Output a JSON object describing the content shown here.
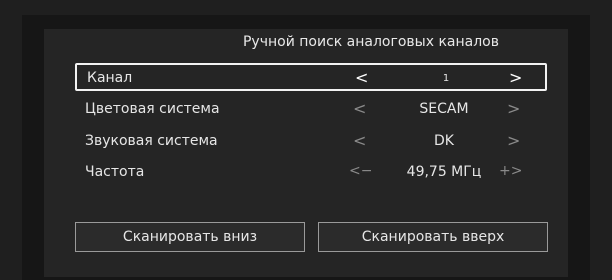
{
  "title": "Ручной поиск аналоговых каналов",
  "rows": [
    {
      "label": "Канал",
      "left": "<",
      "value": "1",
      "right": ">"
    },
    {
      "label": "Цветовая система",
      "left": "<",
      "value": "SECAM",
      "right": ">"
    },
    {
      "label": "Звуковая система",
      "left": "<",
      "value": "DK",
      "right": ">"
    },
    {
      "label": "Частота",
      "left": "<−",
      "value": "49,75 МГц",
      "right": "+>"
    }
  ],
  "buttons": {
    "scan_down": "Сканировать вниз",
    "scan_up": "Сканировать вверх"
  }
}
